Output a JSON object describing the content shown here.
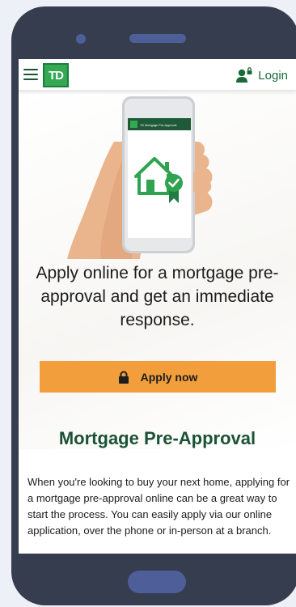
{
  "header": {
    "logo_text": "TD",
    "login_label": "Login"
  },
  "hero": {
    "phone_screen_title": "TD Mortgage Pre-Approval",
    "headline": "Apply online for a mortgage pre-approval and get an immediate response."
  },
  "cta": {
    "apply_label": "Apply now"
  },
  "section": {
    "title": "Mortgage Pre-Approval",
    "body": "When you're looking to buy your next home, applying for a mortgage pre-approval online can be a great way to start the process. You can easily apply via our online application, over the phone or in-person at a branch."
  },
  "colors": {
    "brand_green": "#34a853",
    "dark_green": "#1b5235",
    "cta_orange": "#f29e3c",
    "device_frame": "#363d4e"
  },
  "icons": [
    "menu-icon",
    "person-lock-icon",
    "lock-icon",
    "house-icon",
    "badge-check-icon"
  ]
}
